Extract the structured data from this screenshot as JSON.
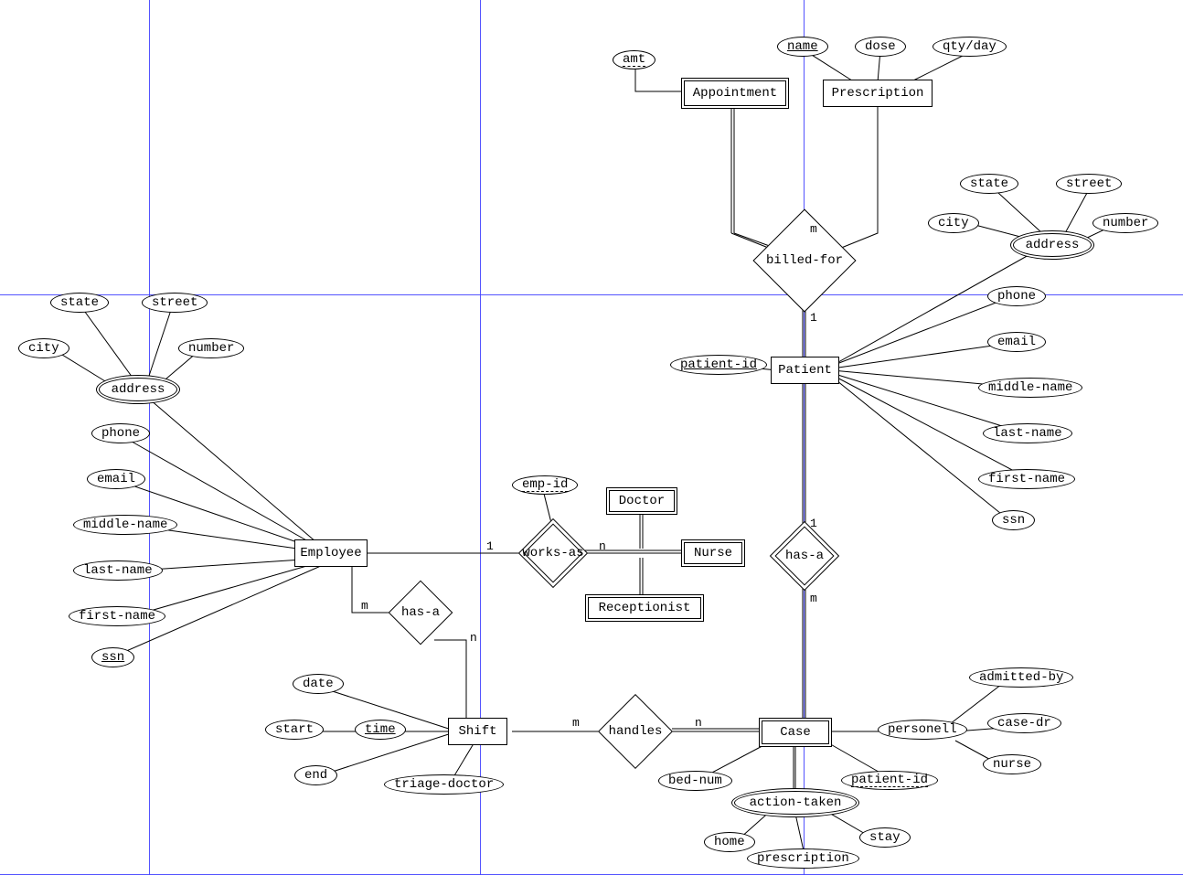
{
  "entities": {
    "employee": "Employee",
    "shift": "Shift",
    "appointment": "Appointment",
    "prescription": "Prescription",
    "patient": "Patient",
    "doctor": "Doctor",
    "nurse": "Nurse",
    "receptionist": "Receptionist",
    "case": "Case"
  },
  "relationships": {
    "billed_for": "billed-for",
    "has_a_emp": "has-a",
    "works_as": "works-as",
    "has_a_pat": "has-a",
    "handles": "handles"
  },
  "cardinalities": {
    "billed_for_m": "m",
    "billed_for_1": "1",
    "has_a_emp_m": "m",
    "has_a_emp_n": "n",
    "works_as_1": "1",
    "works_as_n": "n",
    "has_a_pat_1": "1",
    "has_a_pat_m": "m",
    "handles_m": "m",
    "handles_n": "n"
  },
  "emp_attrs": {
    "state": "state",
    "street": "street",
    "city": "city",
    "number": "number",
    "address": "address",
    "phone": "phone",
    "email": "email",
    "middle_name": "middle-name",
    "last_name": "last-name",
    "first_name": "first-name",
    "ssn": "ssn"
  },
  "pat_attrs": {
    "state": "state",
    "street": "street",
    "city": "city",
    "number": "number",
    "address": "address",
    "phone": "phone",
    "email": "email",
    "middle_name": "middle-name",
    "last_name": "last-name",
    "first_name": "first-name",
    "ssn": "ssn",
    "patient_id": "patient-id"
  },
  "shift_attrs": {
    "date": "date",
    "start": "start",
    "end": "end",
    "time": "time",
    "triage_doctor": "triage-doctor"
  },
  "works_as_attrs": {
    "emp_id": "emp-id"
  },
  "appt_attrs": {
    "amt": "amt"
  },
  "presc_attrs": {
    "name": "name",
    "dose": "dose",
    "qty_day": "qty/day"
  },
  "case_attrs": {
    "bed_num": "bed-num",
    "patient_id": "patient-id",
    "personell": "personell",
    "admitted_by": "admitted-by",
    "case_dr": "case-dr",
    "nurse": "nurse",
    "action_taken": "action-taken",
    "home": "home",
    "prescription": "prescription",
    "stay": "stay"
  }
}
